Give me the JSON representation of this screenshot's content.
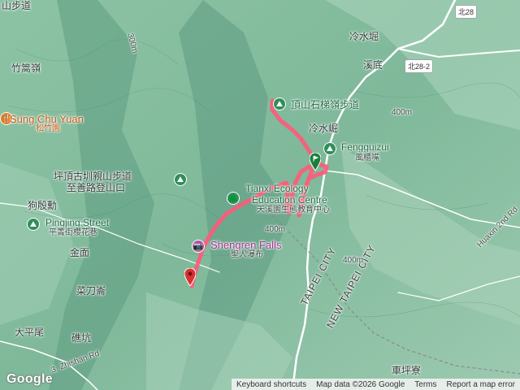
{
  "map": {
    "labels": {
      "top_left_trail": "山步道",
      "beishi": "北28",
      "beishi2": "北28-2",
      "lengshuikeng": "冷水堀",
      "xidi": "溪底",
      "zhuhaoling": "竹篙嶺",
      "tishan": "頂山石梯嶺步道",
      "lengshuiku": "冷水崛",
      "fengguizui_en": "Fengguizui",
      "fengguizui_zh": "風櫃嘴",
      "sungchuyuan_en": "Sung Chu Yuan",
      "sungchuyuan_zh": "松竹園",
      "pingding_trail_1": "坪頂古圳親山步道",
      "pingding_trail_2": "至善路登山口",
      "goudian": "狗殷勳",
      "tianxi_en_1": "Tianxi Ecology",
      "tianxi_en_2": "Education Centre",
      "tianxi_zh": "天溪園生態教育中心",
      "pingjing_en": "Pingjing Street",
      "pingjing_zh": "平菁街櫻花巷",
      "jinmian": "金面",
      "shengren_en": "Shengren Falls",
      "shengren_zh": "聖人瀑布",
      "taipei_city": "TAIPEI CITY",
      "new_taipei_city": "NEW TAIPEI CITY",
      "caidaolun": "菜刀崙",
      "dapingwei": "大平尾",
      "bikeng": "礁坑",
      "zhishan_rd": "3, Zhishan Rd",
      "huaxin_rd": "Huaxin 2nd Rd",
      "chepingliao": "車坪寮",
      "elev_400_a": "400m",
      "elev_400_b": "400m",
      "elev_400_c": "400m",
      "elev_300": "300m"
    },
    "icons": {
      "start_marker": "green-flag-pin-icon",
      "end_marker": "red-pin-icon",
      "tishan_icon": "hiking-trail-icon",
      "fengguizui_icon": "park-icon",
      "sungchuyuan_icon": "restaurant-icon",
      "pingding_icon": "hiking-trail-icon",
      "tianxi_icon": "park-tree-icon",
      "pingjing_icon": "park-icon",
      "shengren_icon": "camera-icon"
    },
    "colors": {
      "route": "#ff5a7a",
      "terrain_dark": "#5e9e84",
      "terrain_light": "#b9dcc6",
      "road": "#ffffff"
    }
  },
  "footer": {
    "google": "Google",
    "shortcuts": "Keyboard shortcuts",
    "map_data": "Map data ©2026 Google",
    "terms": "Terms",
    "report": "Report a map error"
  }
}
